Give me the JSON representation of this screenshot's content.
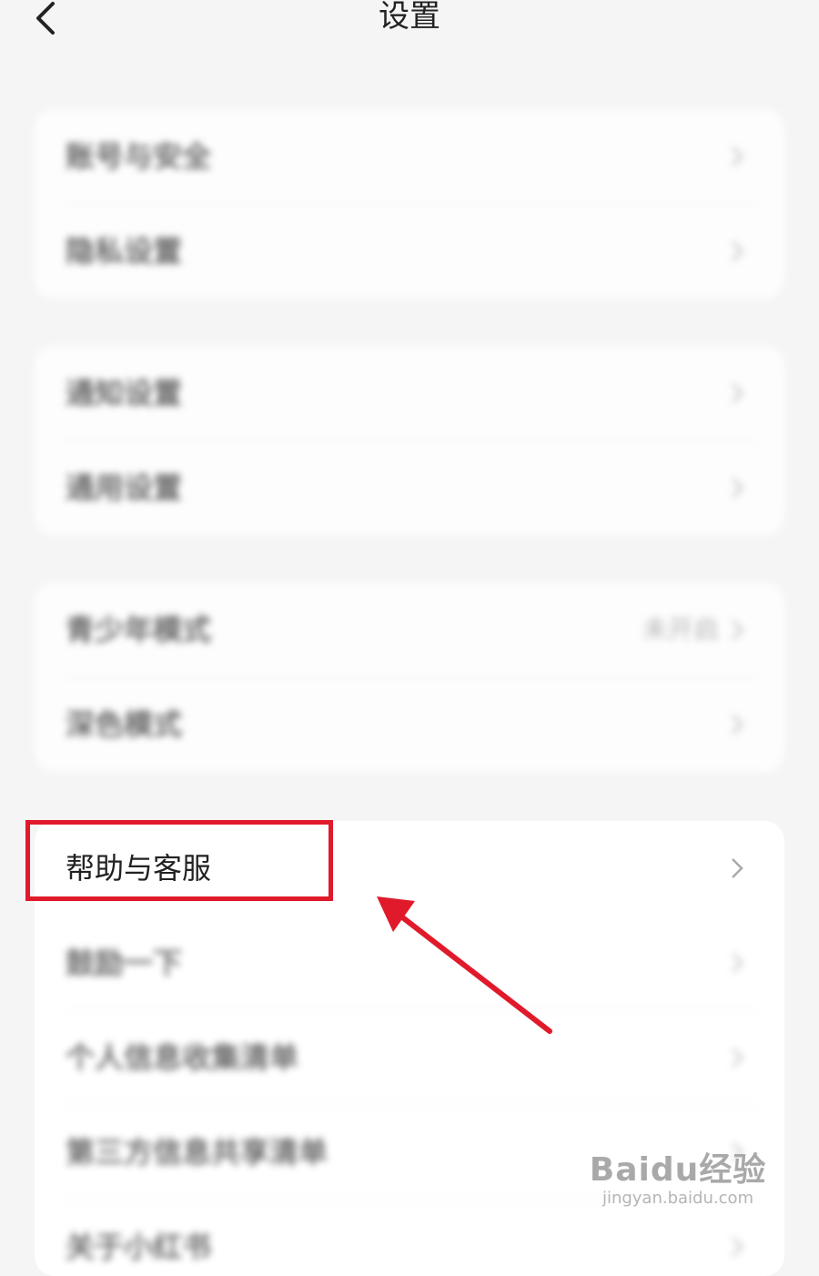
{
  "header": {
    "title": "设置"
  },
  "groups": [
    {
      "items": [
        {
          "label": "账号与安全"
        },
        {
          "label": "隐私设置"
        }
      ]
    },
    {
      "items": [
        {
          "label": "通知设置"
        },
        {
          "label": "通用设置"
        }
      ]
    },
    {
      "items": [
        {
          "label": "青少年模式",
          "value": "未开启"
        },
        {
          "label": "深色模式"
        }
      ]
    },
    {
      "items": [
        {
          "label": "帮助与客服"
        },
        {
          "label": "鼓励一下"
        },
        {
          "label": "个人信息收集清单"
        },
        {
          "label": "第三方信息共享清单"
        },
        {
          "label": "关于小红书"
        }
      ]
    }
  ],
  "annotation": {
    "color": "#e01a2b"
  },
  "watermark": {
    "main": "Baidu经验",
    "sub": "jingyan.baidu.com"
  }
}
